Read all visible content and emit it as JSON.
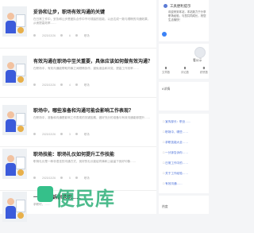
{
  "articles": [
    {
      "title": "妥协和让步，职场有效沟通的关键",
      "excerpt": "在日常工作中，妥协和让步是团队合作中不可或缺的技能，以此达成一致与顺畅的沟通效果，从而提高效率……",
      "date": "2023/12/26",
      "views": "6",
      "category": "职场"
    },
    {
      "title": "有效沟通在职场中至关重要，具体应该如何做有效沟通？",
      "excerpt": "在职场中，有效沟通能帮助同事之间顺畅协作，避免误会和冲突，提高工作效率……",
      "date": "2023/12/26",
      "views": "4",
      "category": "职场"
    },
    {
      "title": "职场中，哪些准备和沟通可能会影响工作表现？",
      "excerpt": "在职场中，准备和沟通是影响工作表现的关键因素，做好充分的准备与有效沟通能够提升……",
      "date": "2023/12/26",
      "views": "3",
      "category": "职场"
    },
    {
      "title": "职场技能：职场礼仪如何提升工作技能",
      "excerpt": "职场礼仪是一种非语言的沟通方式，良好的礼仪能给同事和上级留下良好印象……",
      "date": "2023/12/26",
      "views": "5",
      "category": "职场"
    },
    {
      "title": "一分钟告诉你求职……",
      "excerpt": "求职时，……",
      "date": "",
      "views": "",
      "category": ""
    }
  ],
  "sidebar": {
    "notice_title": "工具便利提示",
    "notice_body": "欢迎来到本站，本站致力于分享职场经验，与您共同成长，祝您生活愉快！",
    "user_name": "看公示",
    "stats": [
      {
        "value": "0",
        "label": "文章数"
      },
      {
        "value": "0",
        "label": "评论数"
      },
      {
        "value": "0",
        "label": "获赞数"
      }
    ],
    "box2_label": "#详情",
    "links": [
      "宣传部长：职业……",
      "职场中，哪些……",
      "求职技能大全……",
      "一分钟告诉你……",
      "日常工作中的……",
      "关于工作经验……",
      "有效沟通……"
    ],
    "box4_label": "热度"
  },
  "watermark": "便民库"
}
